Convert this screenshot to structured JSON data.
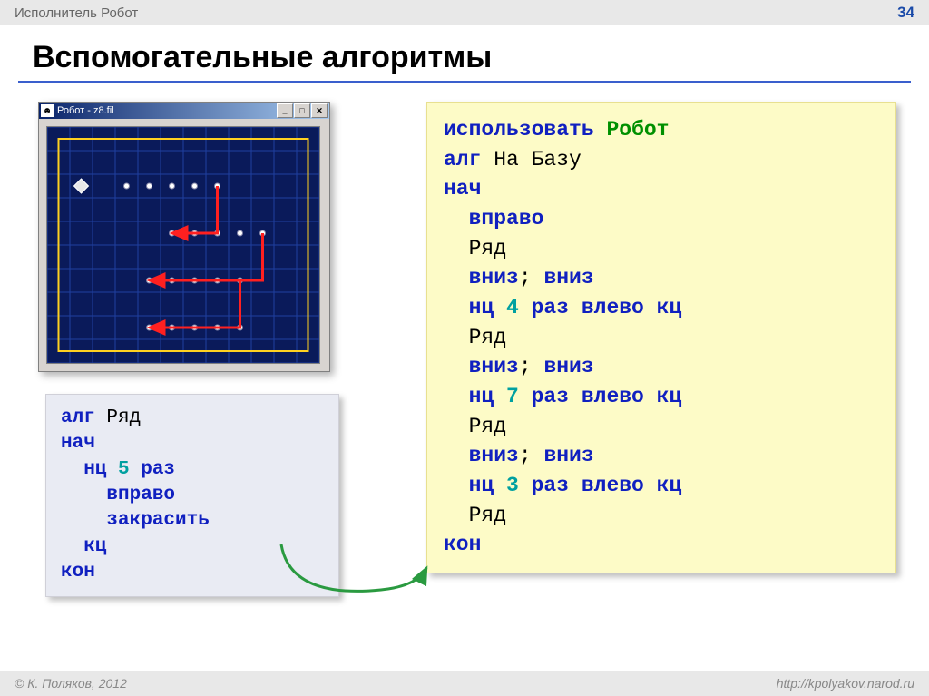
{
  "header": {
    "breadcrumb": "Исполнитель Робот",
    "page_number": "34"
  },
  "title": "Вспомогательные алгоритмы",
  "robot_window": {
    "title": "Робот - z8.fil",
    "grid": {
      "cols": 12,
      "rows": 10,
      "diamond": {
        "r": 2,
        "c": 1
      },
      "border_rect": true,
      "dots": [
        [
          2,
          3
        ],
        [
          2,
          4
        ],
        [
          2,
          5
        ],
        [
          2,
          6
        ],
        [
          2,
          7
        ],
        [
          4,
          5
        ],
        [
          4,
          6
        ],
        [
          4,
          7
        ],
        [
          4,
          8
        ],
        [
          4,
          9
        ],
        [
          6,
          4
        ],
        [
          6,
          5
        ],
        [
          6,
          6
        ],
        [
          6,
          7
        ],
        [
          6,
          8
        ],
        [
          8,
          4
        ],
        [
          8,
          5
        ],
        [
          8,
          6
        ],
        [
          8,
          7
        ],
        [
          8,
          8
        ]
      ],
      "arrows": [
        "M7,2 L7,4 L5,4",
        "M9,4 L9,6 L4,6",
        "M8,6 L8,8 L4,8"
      ]
    }
  },
  "code_small": [
    [
      {
        "cls": "kw-blue",
        "t": "алг "
      },
      {
        "cls": "plain",
        "t": "Ряд"
      }
    ],
    [
      {
        "cls": "kw-blue",
        "t": "нач"
      }
    ],
    [
      {
        "cls": "kw-blue",
        "t": "  нц "
      },
      {
        "cls": "kw-teal",
        "t": "5"
      },
      {
        "cls": "kw-blue",
        "t": " раз"
      }
    ],
    [
      {
        "cls": "kw-blue",
        "t": "    вправо"
      }
    ],
    [
      {
        "cls": "kw-blue",
        "t": "    закрасить"
      }
    ],
    [
      {
        "cls": "kw-blue",
        "t": "  кц"
      }
    ],
    [
      {
        "cls": "kw-blue",
        "t": "кон"
      }
    ]
  ],
  "code_big": [
    [
      {
        "cls": "kw-blue",
        "t": "использовать "
      },
      {
        "cls": "kw-green",
        "t": "Робот"
      }
    ],
    [
      {
        "cls": "kw-blue",
        "t": "алг "
      },
      {
        "cls": "plain",
        "t": "На Базу"
      }
    ],
    [
      {
        "cls": "kw-blue",
        "t": "нач"
      }
    ],
    [
      {
        "cls": "kw-blue",
        "t": "  вправо"
      }
    ],
    [
      {
        "cls": "plain",
        "t": "  Ряд"
      }
    ],
    [
      {
        "cls": "kw-blue",
        "t": "  вниз"
      },
      {
        "cls": "plain",
        "t": "; "
      },
      {
        "cls": "kw-blue",
        "t": "вниз"
      }
    ],
    [
      {
        "cls": "kw-blue",
        "t": "  нц "
      },
      {
        "cls": "kw-teal",
        "t": "4"
      },
      {
        "cls": "kw-blue",
        "t": " раз влево кц"
      }
    ],
    [
      {
        "cls": "plain",
        "t": "  Ряд"
      }
    ],
    [
      {
        "cls": "kw-blue",
        "t": "  вниз"
      },
      {
        "cls": "plain",
        "t": "; "
      },
      {
        "cls": "kw-blue",
        "t": "вниз"
      }
    ],
    [
      {
        "cls": "kw-blue",
        "t": "  нц "
      },
      {
        "cls": "kw-teal",
        "t": "7"
      },
      {
        "cls": "kw-blue",
        "t": " раз влево кц"
      }
    ],
    [
      {
        "cls": "plain",
        "t": "  Ряд"
      }
    ],
    [
      {
        "cls": "kw-blue",
        "t": "  вниз"
      },
      {
        "cls": "plain",
        "t": "; "
      },
      {
        "cls": "kw-blue",
        "t": "вниз"
      }
    ],
    [
      {
        "cls": "kw-blue",
        "t": "  нц "
      },
      {
        "cls": "kw-teal",
        "t": "3"
      },
      {
        "cls": "kw-blue",
        "t": " раз влево кц"
      }
    ],
    [
      {
        "cls": "plain",
        "t": "  Ряд"
      }
    ],
    [
      {
        "cls": "kw-blue",
        "t": "кон"
      }
    ]
  ],
  "footer": {
    "copyright": "© К. Поляков, 2012",
    "url": "http://kpolyakov.narod.ru"
  }
}
